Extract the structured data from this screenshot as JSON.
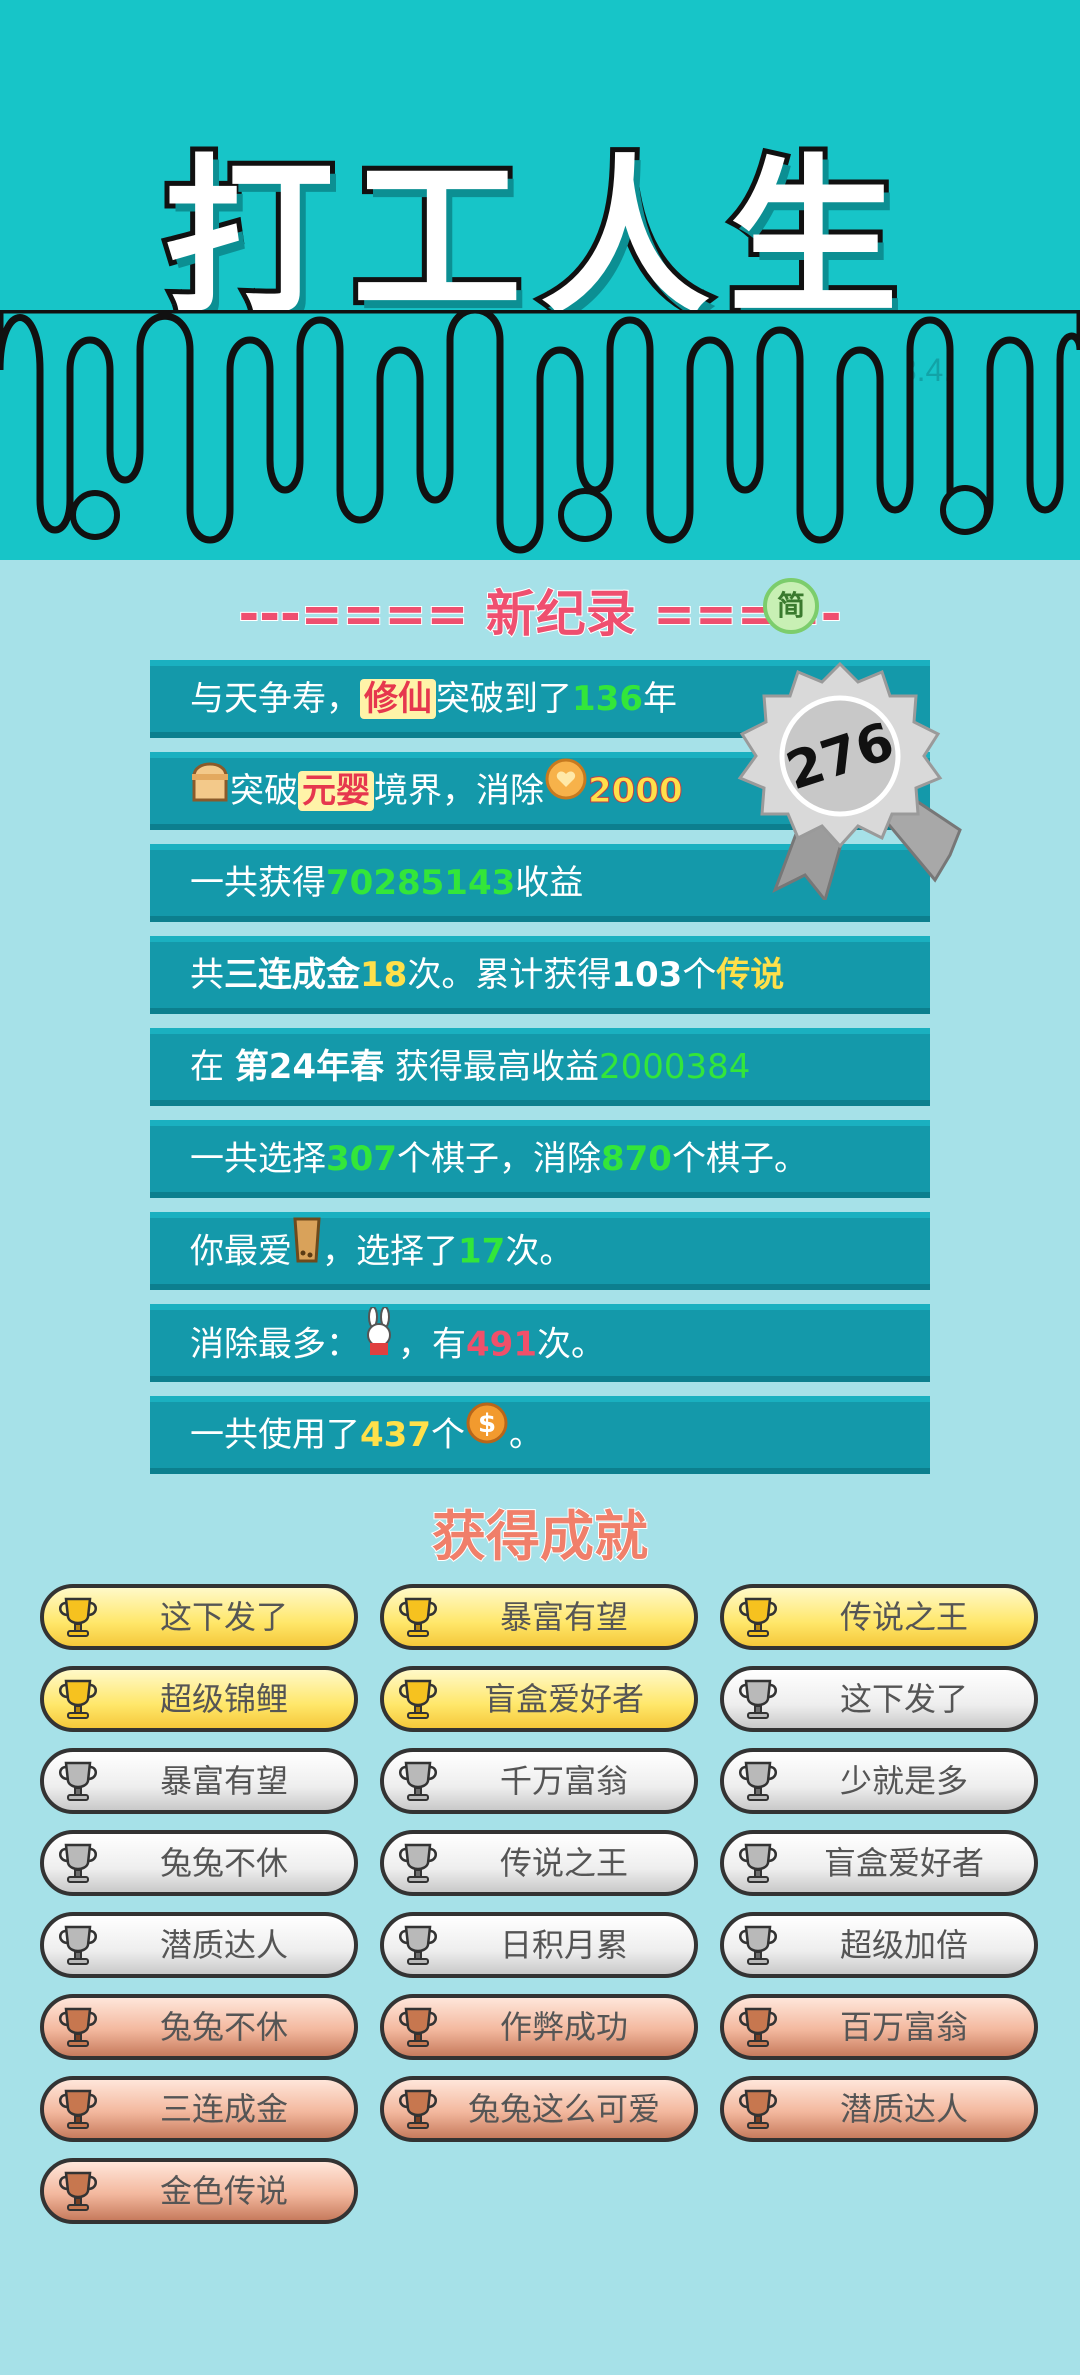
{
  "game": {
    "title": "打工人生",
    "version": "v3.4.9"
  },
  "record": {
    "heading": "---==== 新纪录 ====-",
    "badge": "简",
    "medal_number": "276",
    "rows": [
      {
        "a": "与天争寿，",
        "b": "修仙",
        "c": "突破到了",
        "d": "136",
        "e": "年"
      },
      {
        "b": "元婴",
        "a": "突破",
        "c": "境界，消除",
        "d": "2000"
      },
      {
        "a": "一共获得",
        "d": "70285143",
        "c": "收益"
      },
      {
        "a": "共",
        "b": "三连成金",
        "d": "18",
        "c": "次。累计获得",
        "e": "103",
        "f": "个",
        "g": "传说"
      },
      {
        "a": "在 ",
        "b": "第24年春",
        "c": " 获得最高收益",
        "d": "2000384"
      },
      {
        "a": "一共选择",
        "d": "307",
        "c": "个棋子，消除",
        "e": "870",
        "f": "个棋子。"
      },
      {
        "a": "你最爱",
        "c": "，选择了",
        "d": "17",
        "e": "次。"
      },
      {
        "a": "消除最多：",
        "c": "，有",
        "d": "491",
        "e": "次。"
      },
      {
        "a": "一共使用了",
        "d": "437",
        "c": "个",
        "e": "。"
      }
    ]
  },
  "achievements": {
    "title": "获得成就",
    "items": [
      {
        "label": "这下发了",
        "tier": "gold"
      },
      {
        "label": "暴富有望",
        "tier": "gold"
      },
      {
        "label": "传说之王",
        "tier": "gold"
      },
      {
        "label": "超级锦鲤",
        "tier": "gold"
      },
      {
        "label": "盲盒爱好者",
        "tier": "gold"
      },
      {
        "label": "这下发了",
        "tier": "silver"
      },
      {
        "label": "暴富有望",
        "tier": "silver"
      },
      {
        "label": "千万富翁",
        "tier": "silver"
      },
      {
        "label": "少就是多",
        "tier": "silver"
      },
      {
        "label": "兔兔不休",
        "tier": "silver"
      },
      {
        "label": "传说之王",
        "tier": "silver"
      },
      {
        "label": "盲盒爱好者",
        "tier": "silver"
      },
      {
        "label": "潜质达人",
        "tier": "silver"
      },
      {
        "label": "日积月累",
        "tier": "silver"
      },
      {
        "label": "超级加倍",
        "tier": "silver"
      },
      {
        "label": "兔兔不休",
        "tier": "bronze"
      },
      {
        "label": "作弊成功",
        "tier": "bronze"
      },
      {
        "label": "百万富翁",
        "tier": "bronze"
      },
      {
        "label": "三连成金",
        "tier": "bronze"
      },
      {
        "label": "兔兔这么可爱",
        "tier": "bronze"
      },
      {
        "label": "潜质达人",
        "tier": "bronze"
      },
      {
        "label": "金色传说",
        "tier": "bronze"
      }
    ]
  },
  "colors": {
    "header_bg": "#17c5c8",
    "page_bg": "#a6e1e8",
    "row_bg": "#1499aa",
    "green": "#33e63a",
    "yellow": "#ffe04a",
    "red": "#f0506a"
  },
  "icons": [
    "cap-icon",
    "coin-heart-icon",
    "milk-tea-icon",
    "rabbit-icon",
    "dollar-coin-icon",
    "trophy-icon",
    "medal-icon"
  ]
}
